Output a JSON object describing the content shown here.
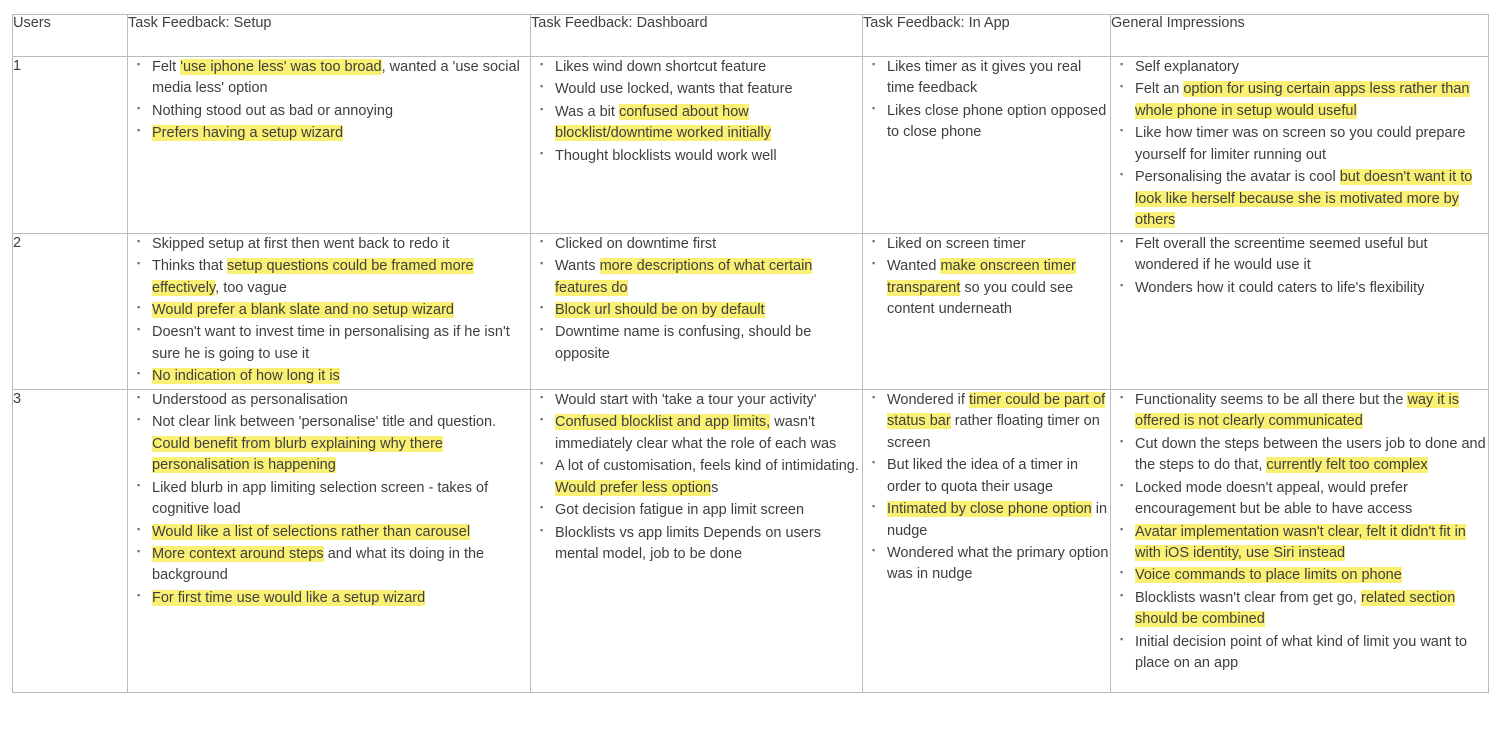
{
  "table": {
    "columns": [
      {
        "key": "users",
        "label": "Users"
      },
      {
        "key": "setup",
        "label": "Task Feedback: Setup"
      },
      {
        "key": "dashboard",
        "label": "Task Feedback: Dashboard"
      },
      {
        "key": "inapp",
        "label": "Task Feedback: In App"
      },
      {
        "key": "general",
        "label": "General Impressions"
      }
    ],
    "highlight_color": "#faf073",
    "border_color": "#b9bcbe",
    "text_color": "#3f3f3f",
    "rows": [
      {
        "user": "1",
        "setup": [
          [
            {
              "t": "Felt "
            },
            {
              "t": "'use iphone less' was too broad",
              "hl": true
            },
            {
              "t": ", wanted a 'use social media less' option"
            }
          ],
          [
            {
              "t": "Nothing stood out as bad or annoying"
            }
          ],
          [
            {
              "t": "Prefers having a setup wizard",
              "hl": true
            }
          ]
        ],
        "dashboard": [
          [
            {
              "t": "Likes wind down shortcut feature"
            }
          ],
          [
            {
              "t": "Would use locked, wants that feature"
            }
          ],
          [
            {
              "t": "Was a bit "
            },
            {
              "t": "confused about how blocklist/downtime worked initially",
              "hl": true
            }
          ],
          [
            {
              "t": "Thought blocklists would work well"
            }
          ]
        ],
        "inapp": [
          [
            {
              "t": "Likes timer as it gives you real time feedback"
            }
          ],
          [
            {
              "t": "Likes close phone option opposed to close phone"
            }
          ]
        ],
        "general": [
          [
            {
              "t": "Self explanatory"
            }
          ],
          [
            {
              "t": "Felt an "
            },
            {
              "t": "option for using certain apps less rather than whole phone in setup would useful",
              "hl": true
            }
          ],
          [
            {
              "t": "Like how timer was on screen so you could prepare yourself for limiter running out"
            }
          ],
          [
            {
              "t": "Personalising the avatar is cool "
            },
            {
              "t": "but doesn't want it to look like herself because she is motivated more by others",
              "hl": true
            }
          ]
        ]
      },
      {
        "user": "2",
        "setup": [
          [
            {
              "t": "Skipped setup at first then went back to redo it"
            }
          ],
          [
            {
              "t": "Thinks that "
            },
            {
              "t": "setup questions could be framed more effectively",
              "hl": true
            },
            {
              "t": ", too vague"
            }
          ],
          [
            {
              "t": "Would prefer a blank slate and no setup wizard",
              "hl": true
            }
          ],
          [
            {
              "t": "Doesn't want to invest time in personalising as if he isn't sure he is going to use it"
            }
          ],
          [
            {
              "t": "No indication of how long it is",
              "hl": true
            }
          ]
        ],
        "dashboard": [
          [
            {
              "t": "Clicked on downtime first"
            }
          ],
          [
            {
              "t": "Wants "
            },
            {
              "t": "more descriptions of what certain features do",
              "hl": true
            }
          ],
          [
            {
              "t": "Block url should be on by default",
              "hl": true
            }
          ],
          [
            {
              "t": "Downtime name is confusing, should be opposite"
            }
          ]
        ],
        "inapp": [
          [
            {
              "t": "Liked on screen timer"
            }
          ],
          [
            {
              "t": "Wanted "
            },
            {
              "t": "make onscreen timer transparent",
              "hl": true
            },
            {
              "t": " so you could see content underneath"
            }
          ]
        ],
        "general": [
          [
            {
              "t": "Felt overall the screentime seemed useful but wondered if he would use it"
            }
          ],
          [
            {
              "t": "Wonders how it could caters to life's flexibility"
            }
          ]
        ]
      },
      {
        "user": "3",
        "setup": [
          [
            {
              "t": "Understood as personalisation"
            }
          ],
          [
            {
              "t": "Not clear link between 'personalise' title and question. "
            },
            {
              "t": "Could benefit from blurb explaining why there personalisation is happening",
              "hl": true
            }
          ],
          [
            {
              "t": "Liked blurb in app limiting selection screen - takes of cognitive load"
            }
          ],
          [
            {
              "t": "Would like a list of selections rather than carousel",
              "hl": true
            }
          ],
          [
            {
              "t": "More context around steps",
              "hl": true
            },
            {
              "t": " and what its doing in the background"
            }
          ],
          [
            {
              "t": "For first time use would like a setup wizard",
              "hl": true
            }
          ]
        ],
        "dashboard": [
          [
            {
              "t": "Would start with 'take a tour your activity'"
            }
          ],
          [
            {
              "t": "Confused blocklist and app limits,",
              "hl": true
            },
            {
              "t": " wasn't immediately clear what the role of each was"
            }
          ],
          [
            {
              "t": "A lot of customisation, feels kind of intimidating. "
            },
            {
              "t": "Would prefer less option",
              "hl": true
            },
            {
              "t": "s"
            }
          ],
          [
            {
              "t": "Got decision fatigue in app limit screen"
            }
          ],
          [
            {
              "t": "Blocklists vs app limits Depends on users mental model, job to be done"
            }
          ]
        ],
        "inapp": [
          [
            {
              "t": "Wondered if "
            },
            {
              "t": "timer could be part of status bar",
              "hl": true
            },
            {
              "t": " rather floating timer on screen"
            }
          ],
          [
            {
              "t": "But liked the idea of a timer in order to quota their usage"
            }
          ],
          [
            {
              "t": "Intimated by close phone option",
              "hl": true
            },
            {
              "t": " in nudge"
            }
          ],
          [
            {
              "t": "Wondered what the primary option was in nudge"
            }
          ]
        ],
        "general": [
          [
            {
              "t": "Functionality seems to be all there but the "
            },
            {
              "t": "way it is offered is not clearly communicated",
              "hl": true
            }
          ],
          [
            {
              "t": "Cut down the steps between the users job to done and the steps to do that, "
            },
            {
              "t": "currently felt too complex",
              "hl": true
            }
          ],
          [
            {
              "t": "Locked mode doesn't appeal, would prefer encouragement but be able to have access"
            }
          ],
          [
            {
              "t": "Avatar implementation wasn't clear, felt it didn't fit in with iOS identity, use Siri instead",
              "hl": true
            }
          ],
          [
            {
              "t": "Voice commands to place limits on phone",
              "hl": true
            }
          ],
          [
            {
              "t": "Blocklists wasn't clear from get go, "
            },
            {
              "t": "related section should be combined",
              "hl": true
            }
          ],
          [
            {
              "t": "Initial decision point of what kind of limit you want to place on an app"
            }
          ]
        ]
      }
    ]
  }
}
